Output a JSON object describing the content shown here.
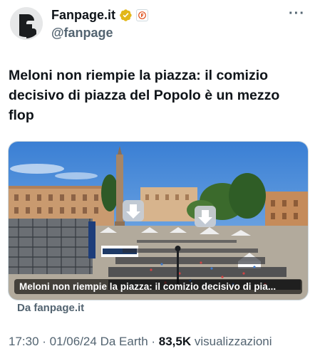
{
  "author": {
    "name": "Fanpage.it",
    "handle": "@fanpage",
    "verified_color": "#e2b719"
  },
  "more_label": "···",
  "tweet": {
    "text": "Meloni non riempie la piazza: il comizio decisivo di piazza del Popolo è un mezzo flop"
  },
  "card": {
    "caption": "Meloni non riempie la piazza: il comizio decisivo di pia...",
    "source": "Da fanpage.it"
  },
  "meta": {
    "time": "17:30",
    "sep1": " · ",
    "date": "01/06/24",
    "via": " Da Earth",
    "sep2": " · ",
    "views_count": "83,5K",
    "views_label": " visualizzazioni"
  }
}
